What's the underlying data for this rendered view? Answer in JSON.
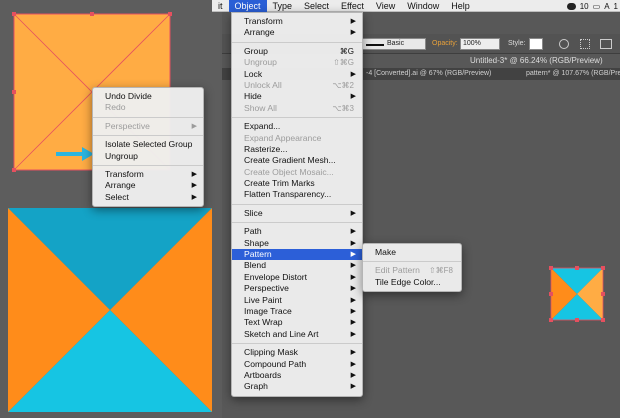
{
  "menubar": {
    "items": [
      "it",
      "Object",
      "Type",
      "Select",
      "Effect",
      "View",
      "Window",
      "Help"
    ],
    "cc_badge": "10",
    "flag_badge": "1"
  },
  "controlbar": {
    "stroke_style": "Basic",
    "opacity_label": "Opacity:",
    "opacity_value": "100%",
    "style_label": "Style:"
  },
  "doc_tabs": {
    "tab1": "-4 [Converted].ai @ 67% (RGB/Preview)",
    "tab2": "Untitled-3* @ 66.24% (RGB/Preview)",
    "tab3": "pattern* @ 107.67% (RGB/Preview)"
  },
  "context_menu": {
    "items": [
      {
        "label": "Undo Divide",
        "disabled": false
      },
      {
        "label": "Redo",
        "disabled": true
      },
      {
        "sep": true
      },
      {
        "label": "Perspective",
        "disabled": true,
        "submenu": true
      },
      {
        "sep": true
      },
      {
        "label": "Isolate Selected Group",
        "disabled": false
      },
      {
        "label": "Ungroup",
        "disabled": false
      },
      {
        "sep": true
      },
      {
        "label": "Transform",
        "disabled": false,
        "submenu": true
      },
      {
        "label": "Arrange",
        "disabled": false,
        "submenu": true
      },
      {
        "label": "Select",
        "disabled": false,
        "submenu": true
      }
    ]
  },
  "object_menu": {
    "items": [
      {
        "label": "Transform",
        "submenu": true
      },
      {
        "label": "Arrange",
        "submenu": true
      },
      {
        "sep": true
      },
      {
        "label": "Group",
        "shortcut": "⌘G"
      },
      {
        "label": "Ungroup",
        "shortcut": "⇧⌘G",
        "disabled": true
      },
      {
        "label": "Lock",
        "submenu": true
      },
      {
        "label": "Unlock All",
        "shortcut": "⌥⌘2",
        "disabled": true
      },
      {
        "label": "Hide",
        "submenu": true
      },
      {
        "label": "Show All",
        "shortcut": "⌥⌘3",
        "disabled": true
      },
      {
        "sep": true
      },
      {
        "label": "Expand..."
      },
      {
        "label": "Expand Appearance",
        "disabled": true
      },
      {
        "label": "Rasterize..."
      },
      {
        "label": "Create Gradient Mesh..."
      },
      {
        "label": "Create Object Mosaic...",
        "disabled": true
      },
      {
        "label": "Create Trim Marks"
      },
      {
        "label": "Flatten Transparency..."
      },
      {
        "sep": true
      },
      {
        "label": "Slice",
        "submenu": true
      },
      {
        "sep": true
      },
      {
        "label": "Path",
        "submenu": true
      },
      {
        "label": "Shape",
        "submenu": true
      },
      {
        "label": "Pattern",
        "submenu": true,
        "highlighted": true
      },
      {
        "label": "Blend",
        "submenu": true
      },
      {
        "label": "Envelope Distort",
        "submenu": true
      },
      {
        "label": "Perspective",
        "submenu": true
      },
      {
        "label": "Live Paint",
        "submenu": true
      },
      {
        "label": "Image Trace",
        "submenu": true
      },
      {
        "label": "Text Wrap",
        "submenu": true
      },
      {
        "label": "Sketch and Line Art",
        "submenu": true
      },
      {
        "sep": true
      },
      {
        "label": "Clipping Mask",
        "submenu": true
      },
      {
        "label": "Compound Path",
        "submenu": true
      },
      {
        "label": "Artboards",
        "submenu": true
      },
      {
        "label": "Graph",
        "submenu": true
      }
    ]
  },
  "pattern_submenu": {
    "items": [
      {
        "label": "Make"
      },
      {
        "sep": true
      },
      {
        "label": "Edit Pattern",
        "shortcut": "⇧⌘F8",
        "disabled": true
      },
      {
        "label": "Tile Edge Color..."
      }
    ]
  },
  "colors": {
    "orange": "#ff8c1a",
    "light_orange": "#ffac44",
    "cyan": "#16c5e3",
    "teal": "#14a3c6",
    "selection": "#e5505f",
    "highlight": "#2c5fd8",
    "arrow": "#2bb5e0"
  }
}
